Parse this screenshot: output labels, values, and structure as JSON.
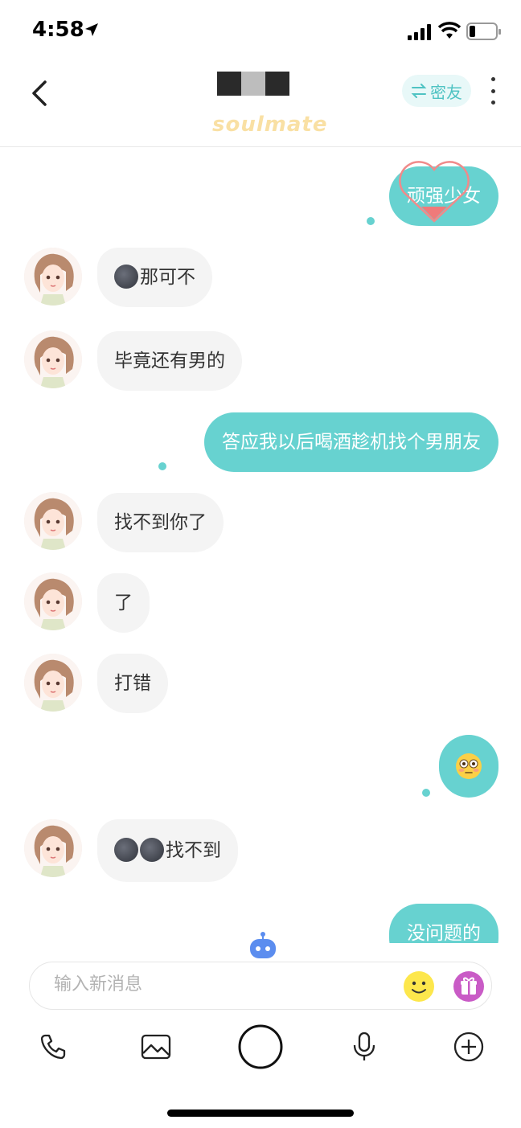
{
  "status_bar": {
    "time": "4:58"
  },
  "header": {
    "relation_label": "密友",
    "logo_text": "soulmate"
  },
  "messages": [
    {
      "side": "out",
      "text": "顽强少女"
    },
    {
      "side": "in",
      "emoji": "new-moon-face",
      "text": "那可不"
    },
    {
      "side": "in",
      "text": "毕竟还有男的"
    },
    {
      "side": "out",
      "text": "答应我以后喝酒趁机找个男朋友"
    },
    {
      "side": "in",
      "text": "找不到你了"
    },
    {
      "side": "in",
      "text": "了"
    },
    {
      "side": "in",
      "text": "打错"
    },
    {
      "side": "out",
      "emoji": "flushed-face"
    },
    {
      "side": "in",
      "emoji": "new-moon-face x2",
      "text": "找不到"
    },
    {
      "side": "out",
      "text": "没问题的"
    }
  ],
  "input": {
    "placeholder": "输入新消息"
  },
  "toolbar": [
    "phone-icon",
    "image-icon",
    "camera-shutter",
    "microphone-icon",
    "plus-icon"
  ],
  "colors": {
    "accent": "#67d2d0",
    "incoming_bubble": "#f4f4f4",
    "relation_pill": "#e8f8f8"
  }
}
